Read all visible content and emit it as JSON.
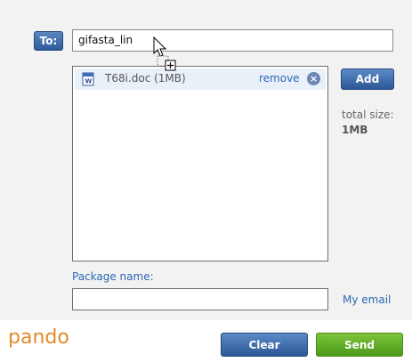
{
  "recipient": {
    "label": "To:",
    "value": "gifasta_lin"
  },
  "attachments": {
    "files": [
      {
        "name": "T68i.doc (1MB)",
        "remove_label": "remove",
        "icon": "word-document-icon"
      }
    ]
  },
  "actions": {
    "add_label": "Add",
    "clear_label": "Clear",
    "send_label": "Send"
  },
  "summary": {
    "total_size_label": "total size:",
    "total_size_value": "1MB"
  },
  "package": {
    "label": "Package name:",
    "value": ""
  },
  "links": {
    "my_email": "My email"
  },
  "brand": {
    "logo_text": "pando",
    "logo_color": "#e38a2c"
  },
  "colors": {
    "accent_blue": "#2d5895",
    "send_green": "#4b9a19"
  }
}
